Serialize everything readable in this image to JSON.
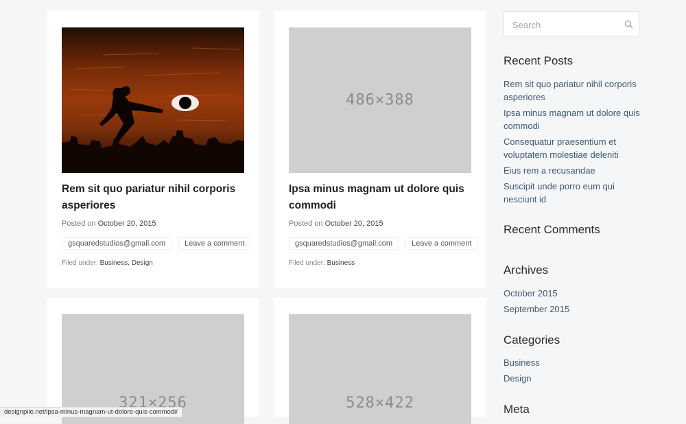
{
  "posts": [
    {
      "title": "Rem sit quo pariatur nihil corporis asperiores",
      "posted_prefix": "Posted on",
      "date": "October 20, 2015",
      "author": "gsquaredstudios@gmail.com",
      "comment_link": "Leave a comment",
      "filed_prefix": "Filed under:",
      "categories": "Business, Design"
    },
    {
      "image_placeholder": "486×388",
      "title": "Ipsa minus magnam ut dolore quis commodi",
      "posted_prefix": "Posted on",
      "date": "October 20, 2015",
      "author": "gsquaredstudios@gmail.com",
      "comment_link": "Leave a comment",
      "filed_prefix": "Filed under:",
      "categories": "Business"
    },
    {
      "image_placeholder": "321×256"
    },
    {
      "image_placeholder": "528×422"
    }
  ],
  "sidebar": {
    "search_placeholder": "Search",
    "recent_posts": {
      "title": "Recent Posts",
      "items": [
        "Rem sit quo pariatur nihil corporis asperiores",
        "Ipsa minus magnam ut dolore quis commodi",
        "Consequatur praesentium et voluptatem molestiae deleniti",
        "Eius rem a recusandae",
        "Suscipit unde porro eum qui nesciunt id"
      ]
    },
    "recent_comments": {
      "title": "Recent Comments"
    },
    "archives": {
      "title": "Archives",
      "items": [
        "October 2015",
        "September 2015"
      ]
    },
    "categories": {
      "title": "Categories",
      "items": [
        "Business",
        "Design"
      ]
    },
    "meta": {
      "title": "Meta"
    }
  },
  "status_url": "designpile.net/ipsa-minus-magnam-ut-dolore-quis-commodi/"
}
